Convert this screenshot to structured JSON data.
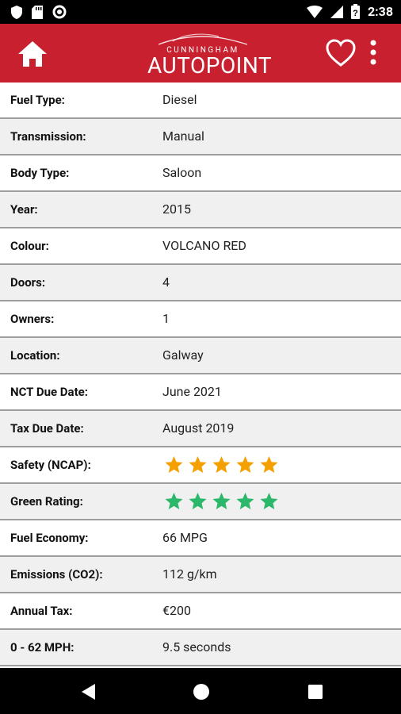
{
  "status_bar": {
    "time": "2:38"
  },
  "app_bar": {
    "logo_top": "CUNNINGHAM",
    "logo_main": "AUTOPOINT"
  },
  "details": [
    {
      "label": "Fuel Type:",
      "value": "Diesel"
    },
    {
      "label": "Transmission:",
      "value": "Manual"
    },
    {
      "label": "Body Type:",
      "value": "Saloon"
    },
    {
      "label": "Year:",
      "value": "2015"
    },
    {
      "label": "Colour:",
      "value": "VOLCANO RED"
    },
    {
      "label": "Doors:",
      "value": "4"
    },
    {
      "label": "Owners:",
      "value": "1"
    },
    {
      "label": "Location:",
      "value": "Galway"
    },
    {
      "label": "NCT Due Date:",
      "value": "June 2021"
    },
    {
      "label": "Tax Due Date:",
      "value": "August 2019"
    },
    {
      "label": "Safety (NCAP):",
      "stars": 5,
      "star_color": "#f4a000"
    },
    {
      "label": "Green Rating:",
      "stars": 5,
      "star_color": "#2bb86a"
    },
    {
      "label": "Fuel Economy:",
      "value": "66 MPG"
    },
    {
      "label": "Emissions (CO2):",
      "value": "112 g/km"
    },
    {
      "label": "Annual Tax:",
      "value": "€200"
    },
    {
      "label": "0 - 62 MPH:",
      "value": "9.5 seconds"
    }
  ],
  "colors": {
    "brand_red": "#c8202f"
  }
}
